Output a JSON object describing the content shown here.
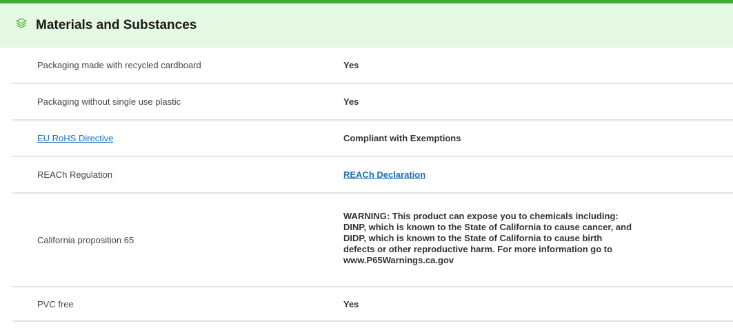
{
  "section": {
    "title": "Materials and Substances",
    "icon": "layers-icon",
    "accent_color": "#3dae2b",
    "header_bg": "#e5f8e3"
  },
  "rows": [
    {
      "label": "Packaging made with recycled cardboard",
      "value": "Yes"
    },
    {
      "label": "Packaging without single use plastic",
      "value": "Yes"
    },
    {
      "label": "EU RoHS Directive",
      "value": "Compliant with Exemptions"
    },
    {
      "label": "REACh Regulation",
      "value": "REACh Declaration"
    },
    {
      "label": "California proposition 65",
      "value": "WARNING: This product can expose you to chemicals including: DINP, which is known to the State of California to cause cancer, and DIDP, which is known to the State of California to cause birth defects or other reproductive harm. For more information go to www.P65Warnings.ca.gov"
    },
    {
      "label": "PVC free",
      "value": "Yes"
    }
  ],
  "link_color": "#1a6fb3"
}
